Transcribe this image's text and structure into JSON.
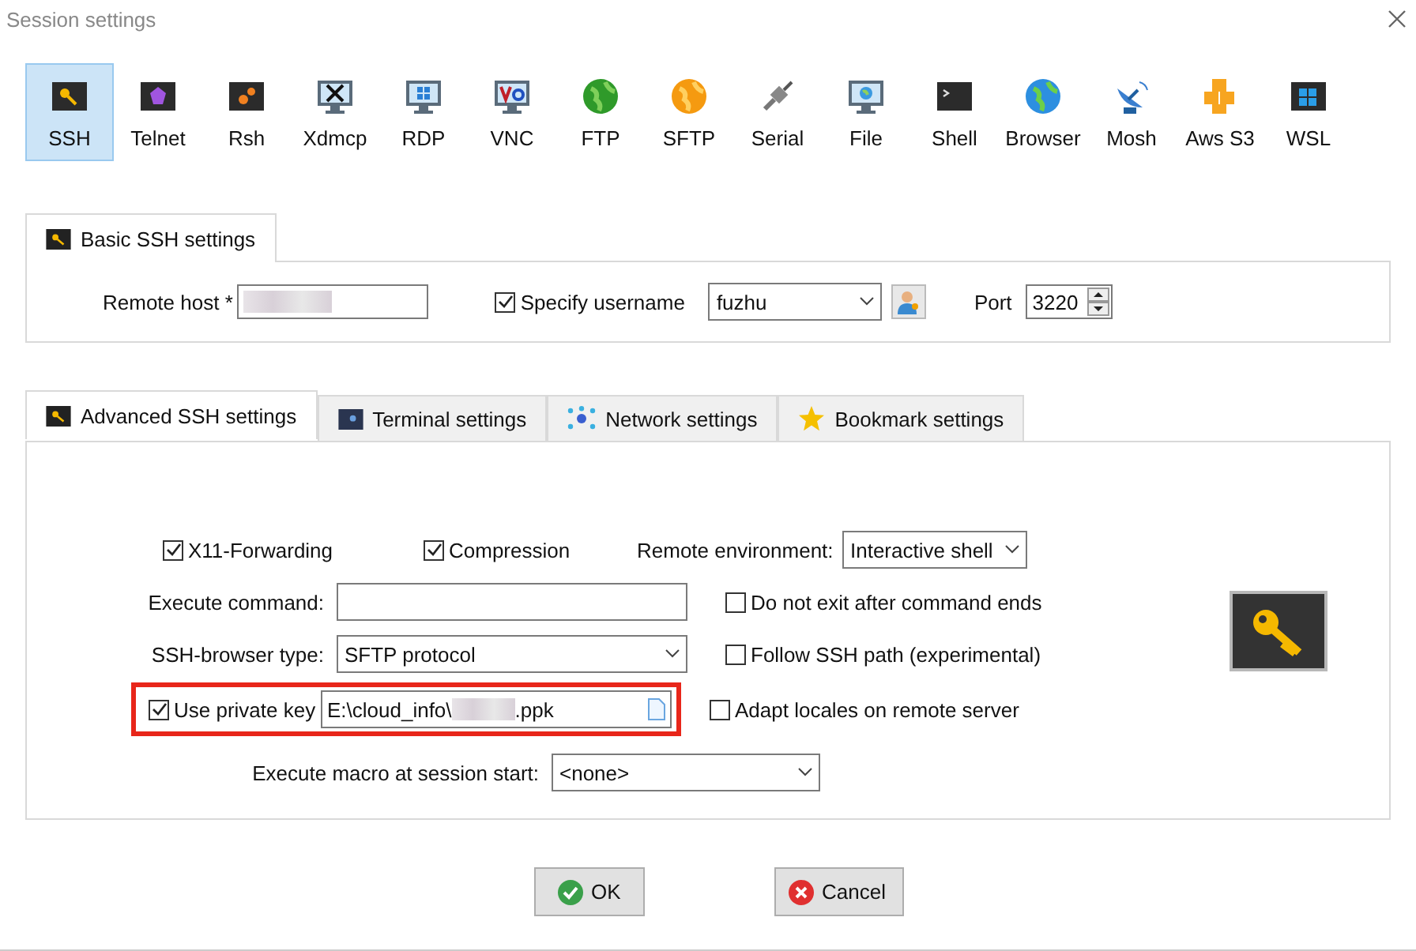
{
  "window": {
    "title": "Session settings"
  },
  "session_types": [
    {
      "label": "SSH",
      "selected": true
    },
    {
      "label": "Telnet",
      "selected": false
    },
    {
      "label": "Rsh",
      "selected": false
    },
    {
      "label": "Xdmcp",
      "selected": false
    },
    {
      "label": "RDP",
      "selected": false
    },
    {
      "label": "VNC",
      "selected": false
    },
    {
      "label": "FTP",
      "selected": false
    },
    {
      "label": "SFTP",
      "selected": false
    },
    {
      "label": "Serial",
      "selected": false
    },
    {
      "label": "File",
      "selected": false
    },
    {
      "label": "Shell",
      "selected": false
    },
    {
      "label": "Browser",
      "selected": false
    },
    {
      "label": "Mosh",
      "selected": false
    },
    {
      "label": "Aws S3",
      "selected": false
    },
    {
      "label": "WSL",
      "selected": false
    }
  ],
  "basic": {
    "tab_label": "Basic SSH settings",
    "remote_host_label": "Remote host *",
    "specify_username": {
      "label": "Specify username",
      "checked": true
    },
    "username": "fuzhu",
    "port_label": "Port",
    "port": "3220"
  },
  "advanced_tabs": [
    {
      "label": "Advanced SSH settings",
      "selected": true
    },
    {
      "label": "Terminal settings",
      "selected": false
    },
    {
      "label": "Network settings",
      "selected": false
    },
    {
      "label": "Bookmark settings",
      "selected": false
    }
  ],
  "advanced": {
    "x11_forwarding": {
      "label": "X11-Forwarding",
      "checked": true
    },
    "compression": {
      "label": "Compression",
      "checked": true
    },
    "remote_environment_label": "Remote environment:",
    "remote_environment": "Interactive shell",
    "execute_command_label": "Execute command:",
    "ssh_browser_type_label": "SSH-browser type:",
    "ssh_browser_type": "SFTP protocol",
    "use_private_key": {
      "label": "Use private key",
      "checked": true
    },
    "private_key_start": "E:\\cloud_info\\",
    "private_key_end": ".ppk",
    "options": [
      {
        "label": "Do not exit after command ends",
        "checked": false
      },
      {
        "label": "Follow SSH path (experimental)",
        "checked": false
      },
      {
        "label": "Adapt locales on remote server",
        "checked": false
      }
    ],
    "macro_label": "Execute macro at session start:",
    "macro": "<none>"
  },
  "buttons": [
    {
      "label": "OK",
      "kind": "ok"
    },
    {
      "label": "Cancel",
      "kind": "cancel"
    }
  ]
}
